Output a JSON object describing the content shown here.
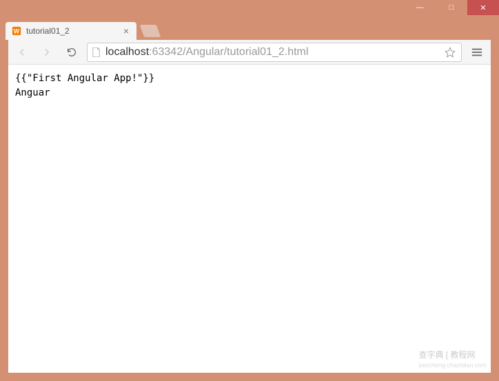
{
  "window": {
    "minimize": "—",
    "maximize": "□",
    "close": "✕"
  },
  "tab": {
    "title": "tutorial01_2",
    "close": "×"
  },
  "url": {
    "host": "localhost",
    "rest": ":63342/Angular/tutorial01_2.html"
  },
  "page": {
    "line1": "{{\"First Angular App!\"}}",
    "line2": "Anguar"
  },
  "watermark": {
    "main": "查字典 [ 教程网",
    "sub": "jiaocheng.chazidian.com"
  }
}
